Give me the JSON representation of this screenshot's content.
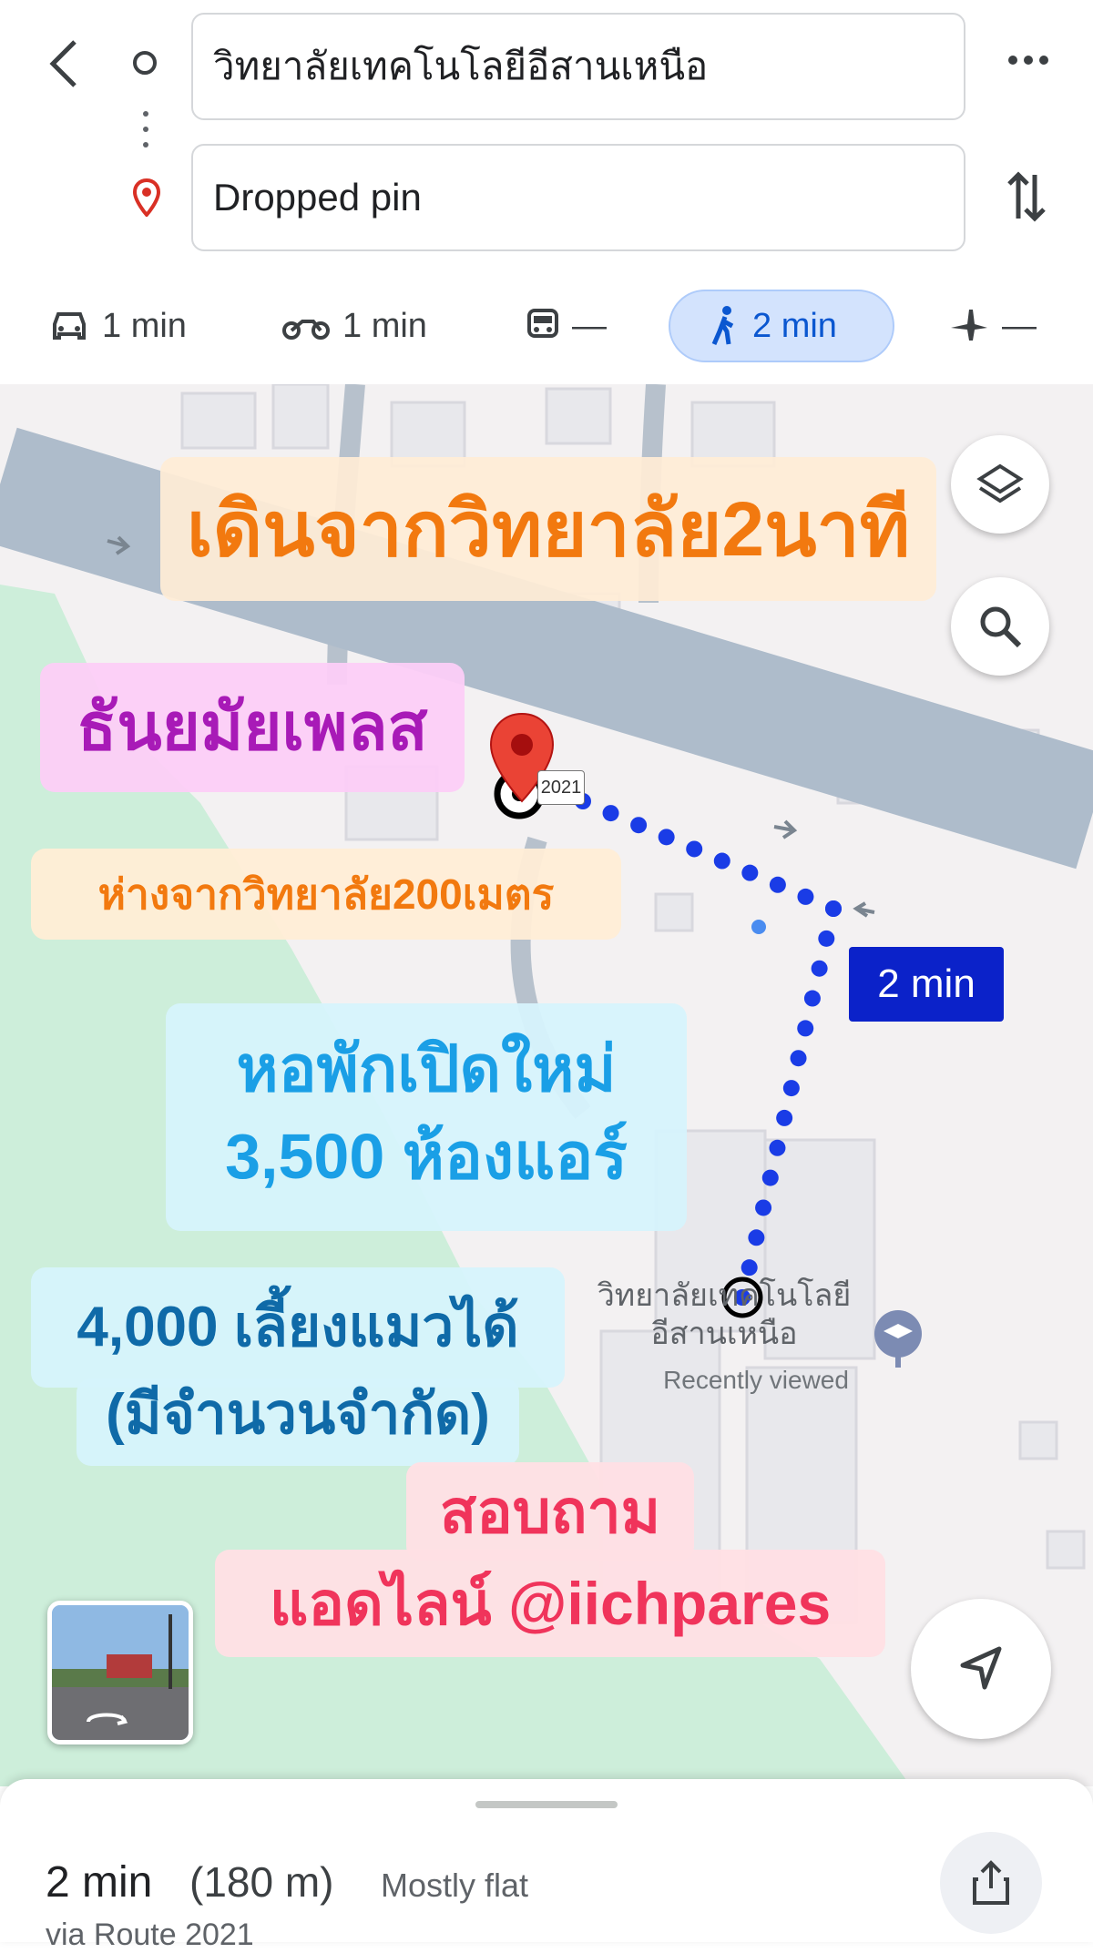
{
  "header": {
    "origin": "วิทยาลัยเทคโนโลยีอีสานเหนือ",
    "destination": "Dropped pin"
  },
  "modes": [
    {
      "icon": "car-icon",
      "label": "1 min"
    },
    {
      "icon": "motorcycle-icon",
      "label": "1 min"
    },
    {
      "icon": "train-icon",
      "label": "—"
    },
    {
      "icon": "walk-icon",
      "label": "2 min",
      "active": true
    },
    {
      "icon": "plane-icon",
      "label": "—"
    }
  ],
  "map": {
    "overlay_title": "เดินจากวิทยาลัย2นาที",
    "overlay_name": "ธันยมัยเพลส",
    "overlay_distance": "ห่างจากวิทยาลัย200เมตร",
    "overlay_dorm_line1": "หอพักเปิดใหม่",
    "overlay_dorm_line2": "3,500 ห้องแอร์",
    "overlay_cat_line1": "4,000 เลี้ยงแมวได้",
    "overlay_cat_line2": "(มีจำนวนจำกัด)",
    "overlay_contact_line1": "สอบถาม",
    "overlay_contact_line2": "แอดไลน์ @iichpares",
    "route_time": "2 min",
    "route_number": "2021",
    "place_label_line1": "วิทยาลัยเทคโนโลยี",
    "place_label_line2": "อีสานเหนือ",
    "place_sublabel": "Recently viewed",
    "route_color": "#1a3ce6",
    "pin_color": "#ea4335"
  },
  "sheet": {
    "duration": "2 min",
    "distance": "(180 m)",
    "terrain": "Mostly flat",
    "via": "via Route 2021"
  }
}
